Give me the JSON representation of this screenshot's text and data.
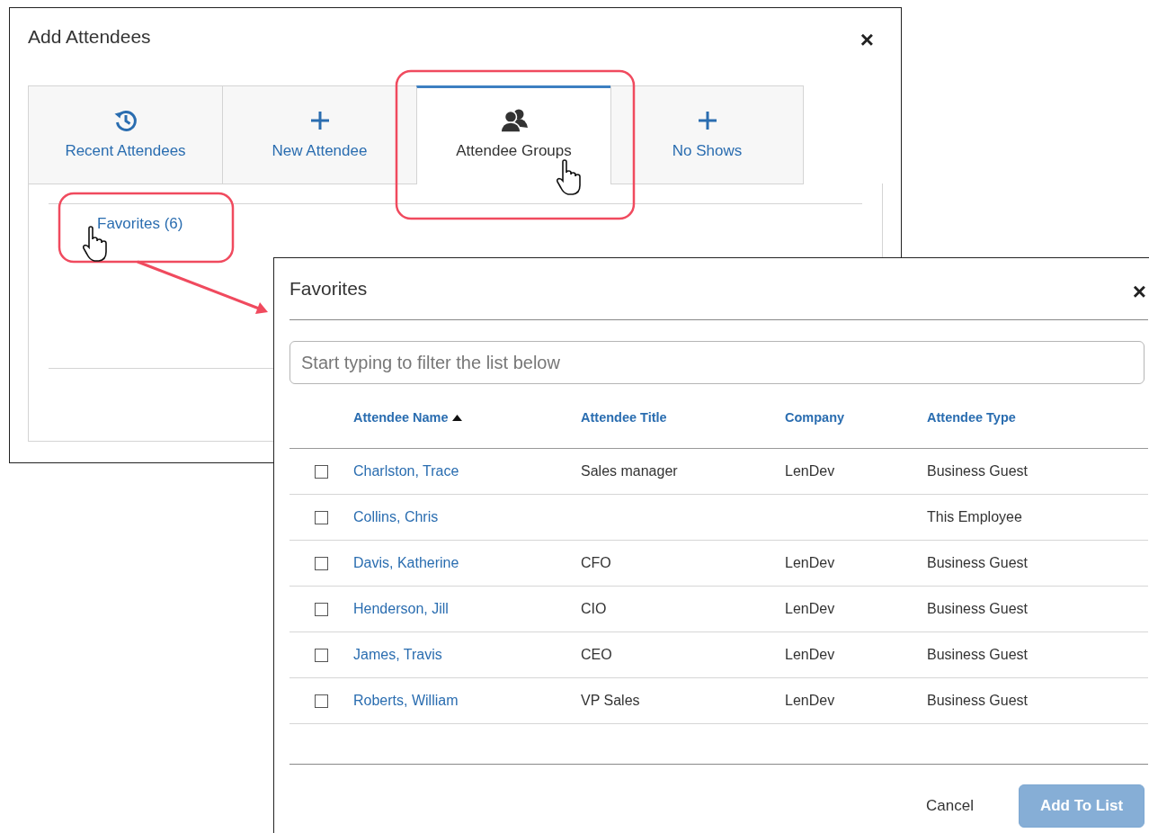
{
  "back_dialog": {
    "title": "Add Attendees",
    "close": "×",
    "tabs": [
      {
        "label": "Recent Attendees",
        "kind": "history",
        "selected": false
      },
      {
        "label": "New Attendee",
        "kind": "plus",
        "selected": false
      },
      {
        "label": "Attendee Groups",
        "kind": "group",
        "selected": true
      },
      {
        "label": "No Shows",
        "kind": "plus",
        "selected": false
      }
    ],
    "groups": [
      {
        "label": "Favorites (6)"
      }
    ]
  },
  "front_dialog": {
    "title": "Favorites",
    "close": "×",
    "search": {
      "placeholder": "Start typing to filter the list below"
    },
    "table": {
      "columns": [
        {
          "label": "Attendee Name",
          "sorted": true
        },
        {
          "label": "Attendee Title",
          "sorted": false
        },
        {
          "label": "Company",
          "sorted": false
        },
        {
          "label": "Attendee Type",
          "sorted": false
        }
      ],
      "rows": [
        {
          "checked": false,
          "name": "Charlston, Trace",
          "title": "Sales manager",
          "company": "LenDev",
          "type": "Business Guest"
        },
        {
          "checked": false,
          "name": "Collins, Chris",
          "type": "This Employee"
        },
        {
          "checked": false,
          "name": "Davis, Katherine",
          "title": "CFO",
          "company": "LenDev",
          "type": "Business Guest"
        },
        {
          "checked": false,
          "name": "Henderson, Jill",
          "title": "CIO",
          "company": "LenDev",
          "type": "Business Guest"
        },
        {
          "checked": false,
          "name": "James, Travis",
          "title": "CEO",
          "company": "LenDev",
          "type": "Business Guest"
        },
        {
          "checked": false,
          "name": "Roberts, William",
          "title": "VP Sales",
          "company": "LenDev",
          "type": "Business Guest"
        }
      ]
    },
    "buttons": [
      {
        "label": "Cancel",
        "kind": "link",
        "disabled": false
      },
      {
        "label": "Add To List",
        "kind": "primary",
        "disabled": true
      }
    ]
  }
}
